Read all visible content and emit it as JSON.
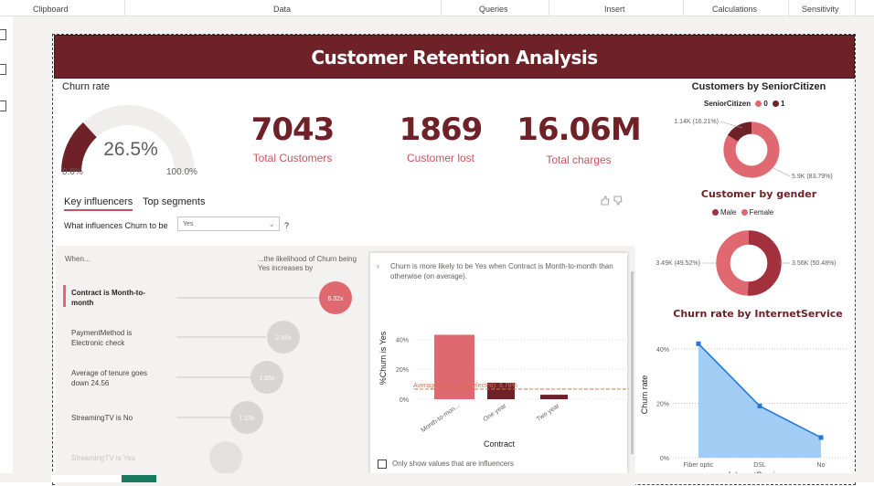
{
  "ribbon": {
    "sections": [
      "Clipboard",
      "Data",
      "Queries",
      "Insert",
      "Calculations",
      "Sensitivity"
    ]
  },
  "title": "Customer Retention Analysis",
  "gauge": {
    "title": "Churn rate",
    "value_label": "26.5%",
    "min_label": "0.0%",
    "max_label": "100.0%",
    "fraction": 0.265,
    "fill_color": "#6e2127",
    "track_color": "#efeeed"
  },
  "kpis": [
    {
      "value": "7043",
      "label": "Total Customers"
    },
    {
      "value": "1869",
      "label": "Customer lost"
    },
    {
      "value": "16.06M",
      "label": "Total charges"
    }
  ],
  "influencers": {
    "tabs": [
      "Key influencers",
      "Top segments"
    ],
    "question_prefix": "What influences Churn to be",
    "question_value": "Yes",
    "question_mark": "?",
    "header_when": "When...",
    "header_likelihood": "...the likelihood of Churn being Yes increases by",
    "icons": [
      "thumbs-up-icon",
      "thumbs-down-icon"
    ],
    "items": [
      {
        "label": "Contract is Month-to-month",
        "value": "6.32x"
      },
      {
        "label": "PaymentMethod is Electronic check",
        "value": "2.65x"
      },
      {
        "label": "Average of tenure goes down 24.56",
        "value": "1.95x"
      },
      {
        "label": "StreamingTV is No",
        "value": "1.53x"
      },
      {
        "label": "StreamingTV is Yes",
        "value": ""
      }
    ],
    "detail": {
      "description": "Churn is more likely to be Yes when Contract is Month-to-month than otherwise (on average).",
      "average_label": "Average (excluding selected): 6.78%",
      "checkbox_label": "Only show values that are influencers"
    }
  },
  "chart_data": [
    {
      "type": "bar",
      "title": "",
      "categories": [
        "Month-to-mon...",
        "One year",
        "Two year"
      ],
      "values": [
        43,
        11,
        3
      ],
      "xlabel": "Contract",
      "ylabel": "%Churn is Yes",
      "ylim": [
        0,
        50
      ],
      "yticks": [
        "0%",
        "20%",
        "40%"
      ],
      "reference_line": 6.78,
      "colors": [
        "#e06870",
        "#6e2127",
        "#6e2127"
      ]
    },
    {
      "type": "pie",
      "title": "Customers by SeniorCitizen",
      "legend_title": "SeniorCitizen",
      "legend": [
        "0",
        "1"
      ],
      "values": [
        5.9,
        1.14
      ],
      "labels": [
        "5.9K (83.79%)",
        "1.14K (16.21%)"
      ],
      "colors": [
        "#e06870",
        "#6e2127"
      ]
    },
    {
      "type": "pie",
      "title": "Customer by gender",
      "legend": [
        "Male",
        "Female"
      ],
      "values": [
        3.56,
        3.49
      ],
      "labels": [
        "3.56K (50.48%)",
        "3.49K (49.52%)"
      ],
      "colors": [
        "#a3303d",
        "#e06870"
      ]
    },
    {
      "type": "area",
      "title": "Churn rate by InternetService",
      "categories": [
        "Fiber optic",
        "DSL",
        "No"
      ],
      "values": [
        41.9,
        19,
        7.4
      ],
      "xlabel": "InternetService",
      "ylabel": "Churn rate",
      "ylim": [
        0,
        45
      ],
      "yticks": [
        "0%",
        "20%",
        "40%"
      ],
      "colors": [
        "#2478d4",
        "#9dcbf4"
      ]
    }
  ]
}
